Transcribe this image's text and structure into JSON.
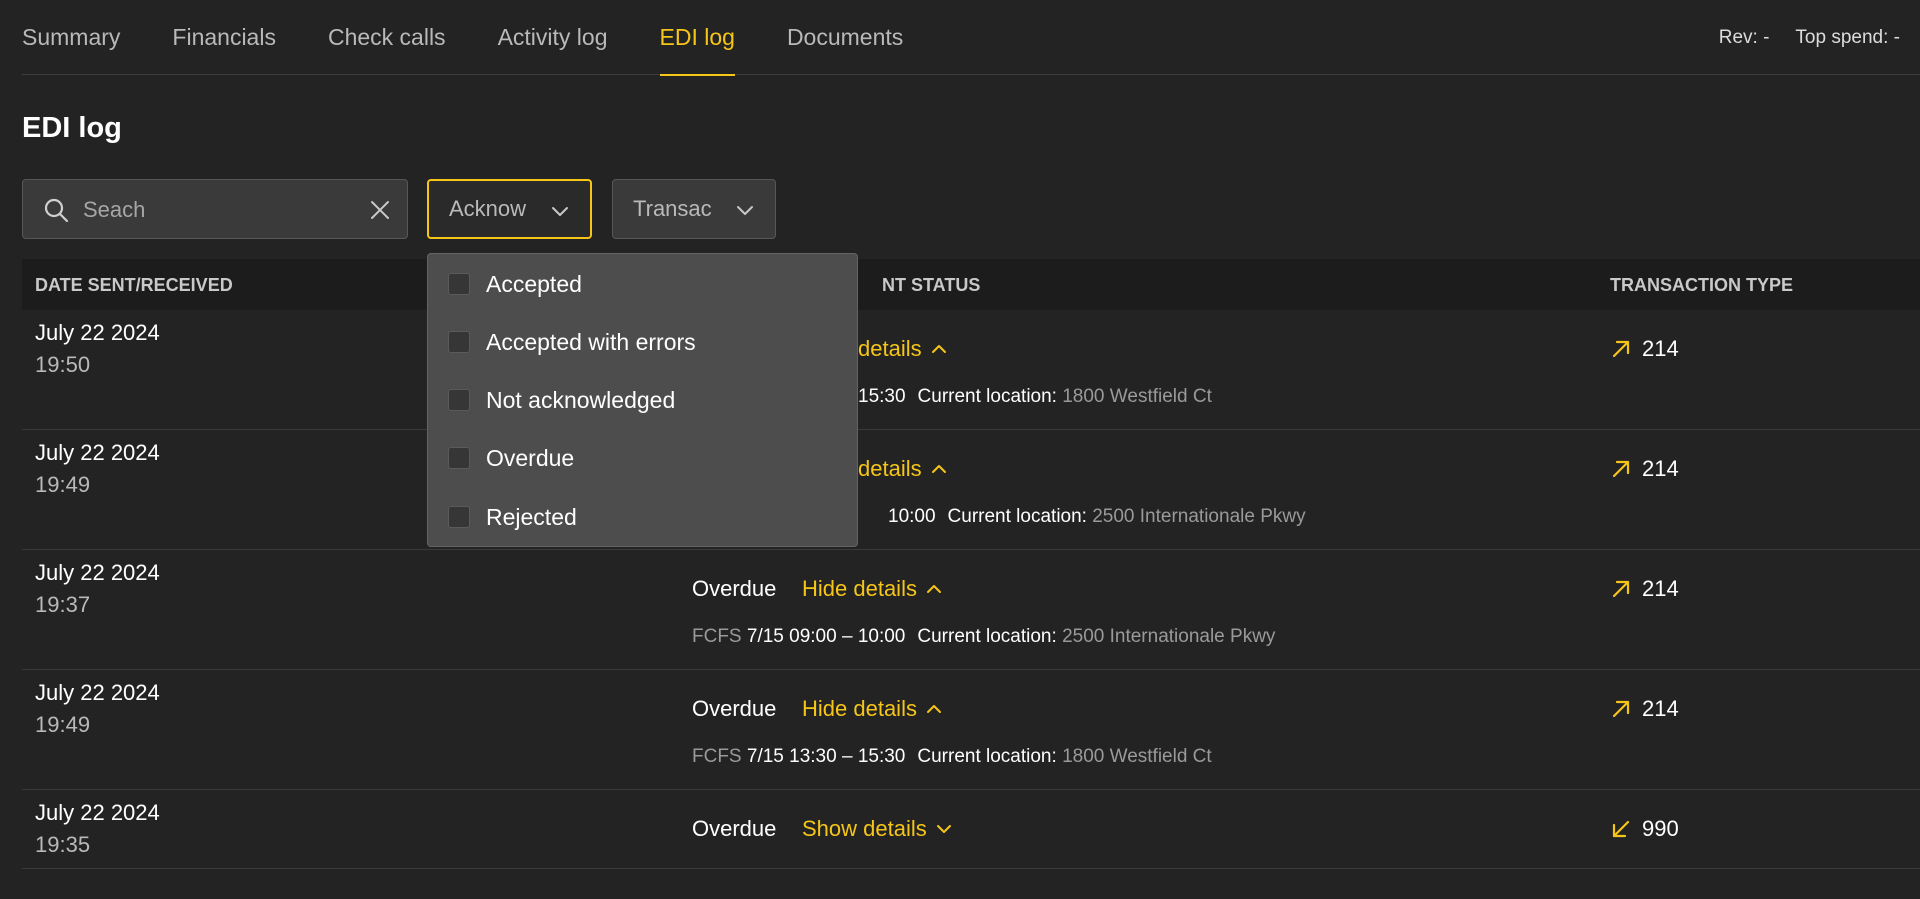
{
  "nav": {
    "tabs": [
      {
        "label": "Summary"
      },
      {
        "label": "Financials"
      },
      {
        "label": "Check calls"
      },
      {
        "label": "Activity log"
      },
      {
        "label": "EDI log",
        "active": true
      },
      {
        "label": "Documents"
      }
    ],
    "rev": "Rev: -",
    "top_spend": "Top spend: -"
  },
  "page": {
    "title": "EDI log"
  },
  "filters": {
    "search_placeholder": "Seach",
    "ack_label": "Acknow",
    "trans_label": "Transac",
    "ack_options": [
      {
        "label": "Accepted",
        "checked": false
      },
      {
        "label": "Accepted with errors",
        "checked": false
      },
      {
        "label": "Not acknowledged",
        "checked": false
      },
      {
        "label": "Overdue",
        "checked": false
      },
      {
        "label": "Rejected",
        "checked": false
      }
    ]
  },
  "table": {
    "headers": {
      "date": "DATE SENT/RECEIVED",
      "status": "NT STATUS",
      "type": "TRANSACTION TYPE"
    },
    "rows": [
      {
        "date": "July 22 2024",
        "time": "19:50",
        "status": "",
        "toggle": "details",
        "expanded": true,
        "appt_label": "",
        "appt_time": "15:30",
        "loc_label": "Current location:",
        "loc_value": "1800 Westfield Ct",
        "direction": "out",
        "type": "214"
      },
      {
        "date": "July 22 2024",
        "time": "19:49",
        "status": "",
        "toggle": "details",
        "expanded": true,
        "appt_label": "",
        "appt_time": "10:00",
        "loc_label": "Current location:",
        "loc_value": "2500 Internationale Pkwy",
        "direction": "out",
        "type": "214"
      },
      {
        "date": "July 22 2024",
        "time": "19:37",
        "status": "Overdue",
        "toggle": "Hide details",
        "expanded": true,
        "appt_label": "FCFS",
        "appt_time": "7/15 09:00 – 10:00",
        "loc_label": "Current location:",
        "loc_value": "2500 Internationale Pkwy",
        "direction": "out",
        "type": "214"
      },
      {
        "date": "July 22 2024",
        "time": "19:49",
        "status": "Overdue",
        "toggle": "Hide details",
        "expanded": true,
        "appt_label": "FCFS",
        "appt_time": "7/15 13:30 – 15:30",
        "loc_label": "Current location:",
        "loc_value": "1800 Westfield Ct",
        "direction": "out",
        "type": "214"
      },
      {
        "date": "July 22 2024",
        "time": "19:35",
        "status": "Overdue",
        "toggle": "Show details",
        "expanded": false,
        "appt_label": "",
        "appt_time": "",
        "loc_label": "",
        "loc_value": "",
        "direction": "in",
        "type": "990"
      }
    ]
  },
  "colors": {
    "accent": "#f5c518",
    "background": "#232323",
    "dropdown": "#4d4d4d"
  }
}
